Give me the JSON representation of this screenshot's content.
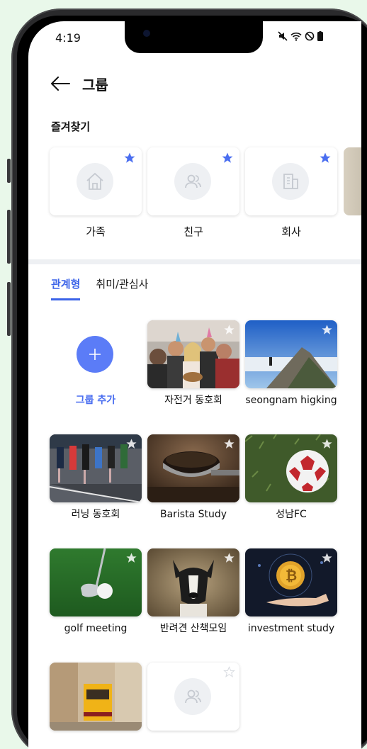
{
  "status_bar": {
    "time": "4:19"
  },
  "header": {
    "title": "그룹"
  },
  "favorites": {
    "title": "즐겨찾기",
    "items": [
      {
        "label": "가족",
        "icon": "home-icon",
        "starred": true
      },
      {
        "label": "친구",
        "icon": "people-icon",
        "starred": true
      },
      {
        "label": "회사",
        "icon": "building-icon",
        "starred": true
      }
    ]
  },
  "tabs": [
    {
      "label": "관계형",
      "active": true
    },
    {
      "label": "취미/관심사",
      "active": false
    }
  ],
  "groups": {
    "add_label": "그룹 추가",
    "items": [
      {
        "label": "자전거 동호회",
        "image": "party-photo"
      },
      {
        "label": "seongnam higking",
        "image": "mountain-photo"
      },
      {
        "label": "러닝 동호회",
        "image": "marathon-photo"
      },
      {
        "label": "Barista Study",
        "image": "coffee-photo"
      },
      {
        "label": "성남FC",
        "image": "soccer-ball-photo"
      },
      {
        "label": "golf meeting",
        "image": "golf-photo"
      },
      {
        "label": "반려견 산책모임",
        "image": "dog-photo"
      },
      {
        "label": "investment study",
        "image": "bitcoin-photo"
      },
      {
        "label": "",
        "image": "tram-photo"
      },
      {
        "label": "",
        "image": "placeholder-people"
      }
    ]
  },
  "colors": {
    "accent": "#3b63e8",
    "star": "#4a6ef0",
    "add_button": "#5b7cf7"
  }
}
